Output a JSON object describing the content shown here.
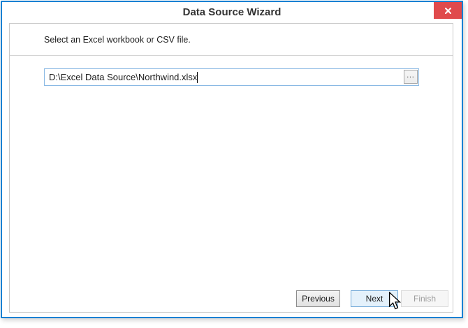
{
  "window": {
    "title": "Data Source Wizard",
    "close_icon": "close-x"
  },
  "content": {
    "instruction": "Select an Excel workbook or CSV file.",
    "file_input": {
      "value": "D:\\Excel Data Source\\Northwind.xlsx",
      "browse_label": "…"
    },
    "footer": {
      "previous_label": "Previous",
      "next_label": "Next",
      "finish_label": "Finish",
      "next_state": "hovered",
      "finish_state": "disabled"
    }
  },
  "colors": {
    "window_border": "#1581d3",
    "close_bg": "#e04a4c",
    "panel_border": "#c9c9c9",
    "focus_border": "#8ab9e4",
    "next_hover_bg": "#e4f1fb",
    "next_hover_border": "#71a8d7",
    "disabled_text": "#9e9e9e"
  }
}
